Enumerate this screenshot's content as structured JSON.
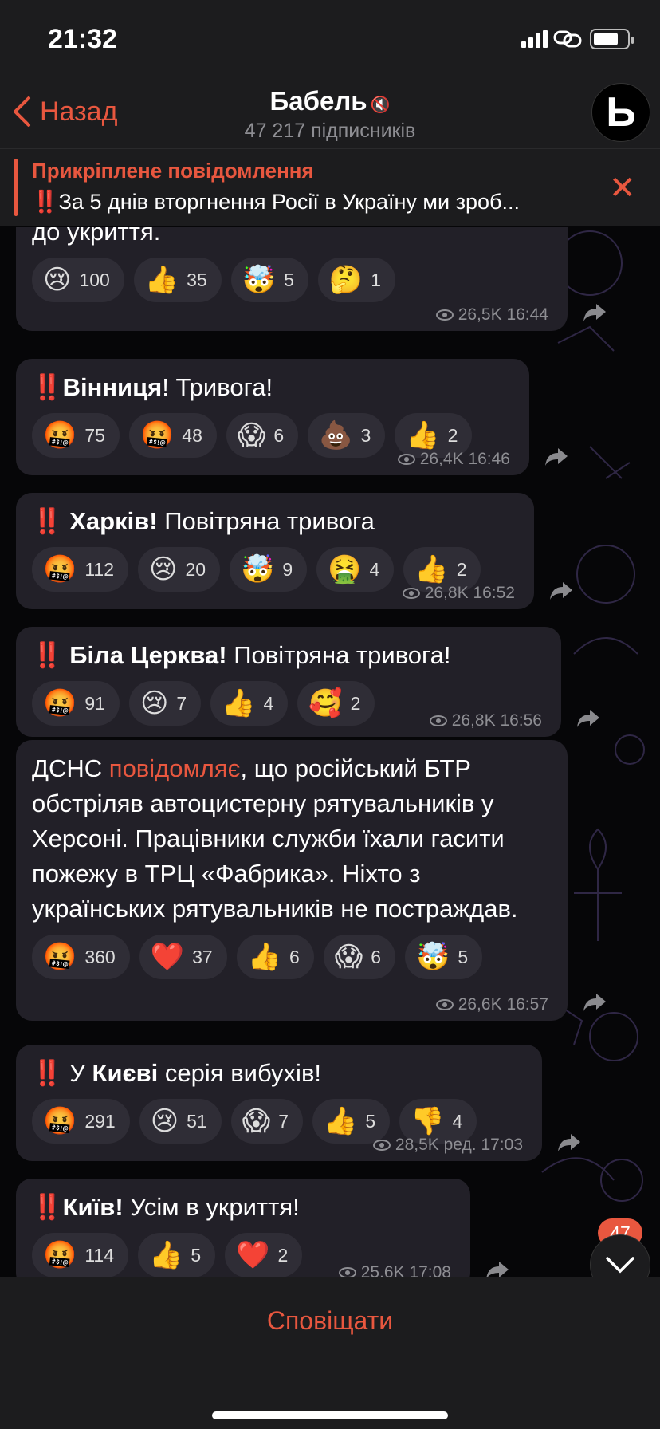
{
  "status": {
    "time": "21:32"
  },
  "header": {
    "back_label": "Назад",
    "title": "Бабель",
    "subscribers": "47 217 підписників",
    "avatar_letter": "Ь"
  },
  "pinned": {
    "title": "Прикріплене повідомлення",
    "text": "‼️За 5 днів вторгнення Росії в Україну ми зроб..."
  },
  "messages": [
    {
      "parts": [
        [
          "до укриття.",
          false
        ]
      ],
      "reactions": [
        [
          "😢",
          "100"
        ],
        [
          "👍",
          "35"
        ],
        [
          "🤯",
          "5"
        ],
        [
          "🤔",
          "1"
        ]
      ],
      "views": "26,5K",
      "time": "16:44"
    },
    {
      "parts": [
        [
          "‼️",
          false
        ],
        [
          "Вінниця",
          true
        ],
        [
          "! Тривога!",
          false
        ]
      ],
      "reactions": [
        [
          "🤬",
          "75"
        ],
        [
          "🤬",
          "48"
        ],
        [
          "😱",
          "6"
        ],
        [
          "💩",
          "3"
        ],
        [
          "👍",
          "2"
        ]
      ],
      "views": "26,4K",
      "time": "16:46"
    },
    {
      "parts": [
        [
          "‼️ ",
          false
        ],
        [
          "Харків!",
          true
        ],
        [
          " Повітряна тривога",
          false
        ]
      ],
      "reactions": [
        [
          "🤬",
          "112"
        ],
        [
          "😢",
          "20"
        ],
        [
          "🤯",
          "9"
        ],
        [
          "🤮",
          "4"
        ],
        [
          "👍",
          "2"
        ]
      ],
      "views": "26,8K",
      "time": "16:52"
    },
    {
      "parts": [
        [
          "‼️ ",
          false
        ],
        [
          "Біла Церква!",
          true
        ],
        [
          " Повітряна тривога!",
          false
        ]
      ],
      "reactions": [
        [
          "🤬",
          "91"
        ],
        [
          "😢",
          "7"
        ],
        [
          "👍",
          "4"
        ],
        [
          "🥰",
          "2"
        ]
      ],
      "views": "26,8K",
      "time": "16:56"
    },
    {
      "parts": [
        [
          "ДСНС ",
          false
        ],
        [
          "повідомляє",
          "link"
        ],
        [
          ", що російський БТР обстріляв автоцистерну рятувальників у Херсоні. Працівники служби їхали гасити пожежу в ТРЦ «Фабрика». Ніхто з українських рятувальників не постраждав.",
          false
        ]
      ],
      "reactions": [
        [
          "🤬",
          "360"
        ],
        [
          "❤️",
          "37"
        ],
        [
          "👍",
          "6"
        ],
        [
          "😱",
          "6"
        ],
        [
          "🤯",
          "5"
        ]
      ],
      "views": "26,6K",
      "time": "16:57"
    },
    {
      "parts": [
        [
          "‼️ У ",
          false
        ],
        [
          "Києві",
          true
        ],
        [
          " серія вибухів!",
          false
        ]
      ],
      "reactions": [
        [
          "🤬",
          "291"
        ],
        [
          "😢",
          "51"
        ],
        [
          "😱",
          "7"
        ],
        [
          "👍",
          "5"
        ],
        [
          "👎",
          "4"
        ]
      ],
      "views": "28,5K",
      "time": "ред. 17:03"
    },
    {
      "parts": [
        [
          "‼️",
          false
        ],
        [
          "Київ!",
          true
        ],
        [
          " Усім в укриття!",
          false
        ]
      ],
      "reactions": [
        [
          "🤬",
          "114"
        ],
        [
          "👍",
          "5"
        ],
        [
          "❤️",
          "2"
        ]
      ],
      "views": "25,6K",
      "time": "17:08"
    }
  ],
  "unread_badge": "47",
  "bottom": {
    "notify_label": "Сповіщати"
  },
  "colors": {
    "accent": "#e8573f",
    "bubble": "#222028",
    "chip": "#2f2d36"
  }
}
